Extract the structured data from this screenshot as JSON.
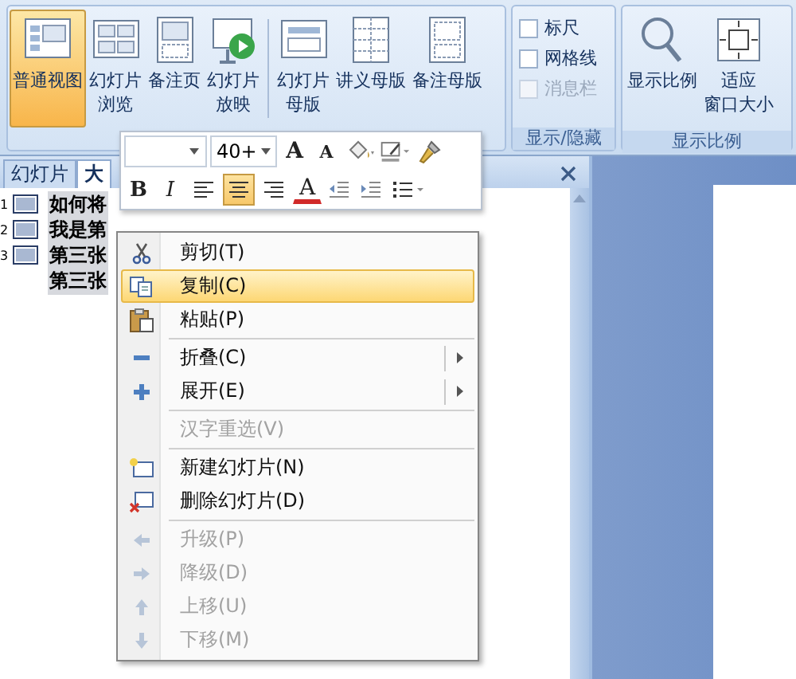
{
  "ribbon": {
    "presentation_views": [
      {
        "lines": [
          "普通视图"
        ],
        "selected": true
      },
      {
        "lines": [
          "幻灯片",
          "浏览"
        ],
        "selected": false
      },
      {
        "lines": [
          "备注页"
        ],
        "selected": false
      },
      {
        "lines": [
          "幻灯片",
          "放映"
        ],
        "selected": false
      }
    ],
    "master_views": [
      {
        "lines": [
          "幻灯片",
          "母版"
        ],
        "selected": false
      },
      {
        "lines": [
          "讲义母版"
        ],
        "selected": false
      },
      {
        "lines": [
          "备注母版"
        ],
        "selected": false
      }
    ],
    "show_hide": {
      "label": "显示/隐藏",
      "options": [
        {
          "label": "标尺",
          "checked": false,
          "disabled": false
        },
        {
          "label": "网格线",
          "checked": false,
          "disabled": false
        },
        {
          "label": "消息栏",
          "checked": false,
          "disabled": true
        }
      ]
    },
    "zoom": {
      "label": "显示比例",
      "buttons": [
        {
          "lines": [
            "显示比例"
          ]
        },
        {
          "lines": [
            "适应",
            "窗口大小"
          ]
        }
      ]
    }
  },
  "outline_pane": {
    "tabs": [
      {
        "label": "幻灯片",
        "selected": false
      },
      {
        "label": "大",
        "selected": true
      }
    ],
    "rows": [
      {
        "kind": "slide",
        "number": "1",
        "text": "如何将"
      },
      {
        "kind": "slide",
        "number": "2",
        "text": "我是第"
      },
      {
        "kind": "slide",
        "number": "3",
        "text": "第三张"
      },
      {
        "kind": "body",
        "text": "第三张"
      }
    ]
  },
  "mini_toolbar": {
    "font_size": "40+",
    "top_tools": [
      {
        "kind": "grow",
        "label": "A"
      },
      {
        "kind": "shrink",
        "label": "A"
      },
      {
        "kind": "fill"
      },
      {
        "kind": "outline"
      },
      {
        "kind": "painter"
      }
    ],
    "bottom_tools": [
      {
        "kind": "bold",
        "label": "B"
      },
      {
        "kind": "italic",
        "label": "I"
      },
      {
        "kind": "align-left",
        "selected": false
      },
      {
        "kind": "align-center",
        "selected": true
      },
      {
        "kind": "align-right",
        "selected": false
      },
      {
        "kind": "font-color",
        "label": "A"
      },
      {
        "kind": "outdent"
      },
      {
        "kind": "indent"
      },
      {
        "kind": "bullets"
      }
    ]
  },
  "context_menu": {
    "groups": [
      [
        {
          "label": "剪切(T)",
          "selected": false,
          "disabled": false,
          "submenu": false
        },
        {
          "label": "复制(C)",
          "selected": true,
          "disabled": false,
          "submenu": false
        },
        {
          "label": "粘贴(P)",
          "selected": false,
          "disabled": false,
          "submenu": false
        }
      ],
      [
        {
          "label": "折叠(C)",
          "selected": false,
          "disabled": false,
          "submenu": true
        },
        {
          "label": "展开(E)",
          "selected": false,
          "disabled": false,
          "submenu": true
        }
      ],
      [
        {
          "label": "汉字重选(V)",
          "selected": false,
          "disabled": true,
          "submenu": false
        }
      ],
      [
        {
          "label": "新建幻灯片(N)",
          "selected": false,
          "disabled": false,
          "submenu": false
        },
        {
          "label": "删除幻灯片(D)",
          "selected": false,
          "disabled": false,
          "submenu": false
        }
      ],
      [
        {
          "label": "升级(P)",
          "selected": false,
          "disabled": true,
          "submenu": false
        },
        {
          "label": "降级(D)",
          "selected": false,
          "disabled": true,
          "submenu": false
        },
        {
          "label": "上移(U)",
          "selected": false,
          "disabled": true,
          "submenu": false
        },
        {
          "label": "下移(M)",
          "selected": false,
          "disabled": true,
          "submenu": false
        }
      ]
    ]
  }
}
